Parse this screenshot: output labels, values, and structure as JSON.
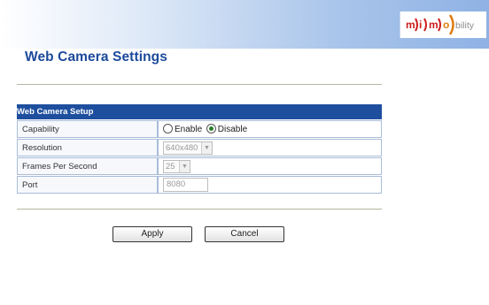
{
  "brand": {
    "logo_letters": [
      "m",
      "i",
      "m",
      "o"
    ],
    "logo_suffix": "bility"
  },
  "page": {
    "title": "Web Camera Settings"
  },
  "setup": {
    "header": "Web Camera Setup",
    "rows": [
      {
        "label": "Capability"
      },
      {
        "label": "Resolution"
      },
      {
        "label": "Frames Per Second"
      },
      {
        "label": "Port"
      }
    ],
    "capability": {
      "enable_label": "Enable",
      "disable_label": "Disable",
      "selected": "Disable"
    },
    "resolution_value": "640x480",
    "fps_value": "25",
    "port_value": "8080"
  },
  "buttons": {
    "apply": "Apply",
    "cancel": "Cancel"
  },
  "colors": {
    "title": "#1c4a9c",
    "table_header": "#1e4f9e",
    "logo_red": "#cc2020",
    "logo_orange": "#e07a10"
  }
}
